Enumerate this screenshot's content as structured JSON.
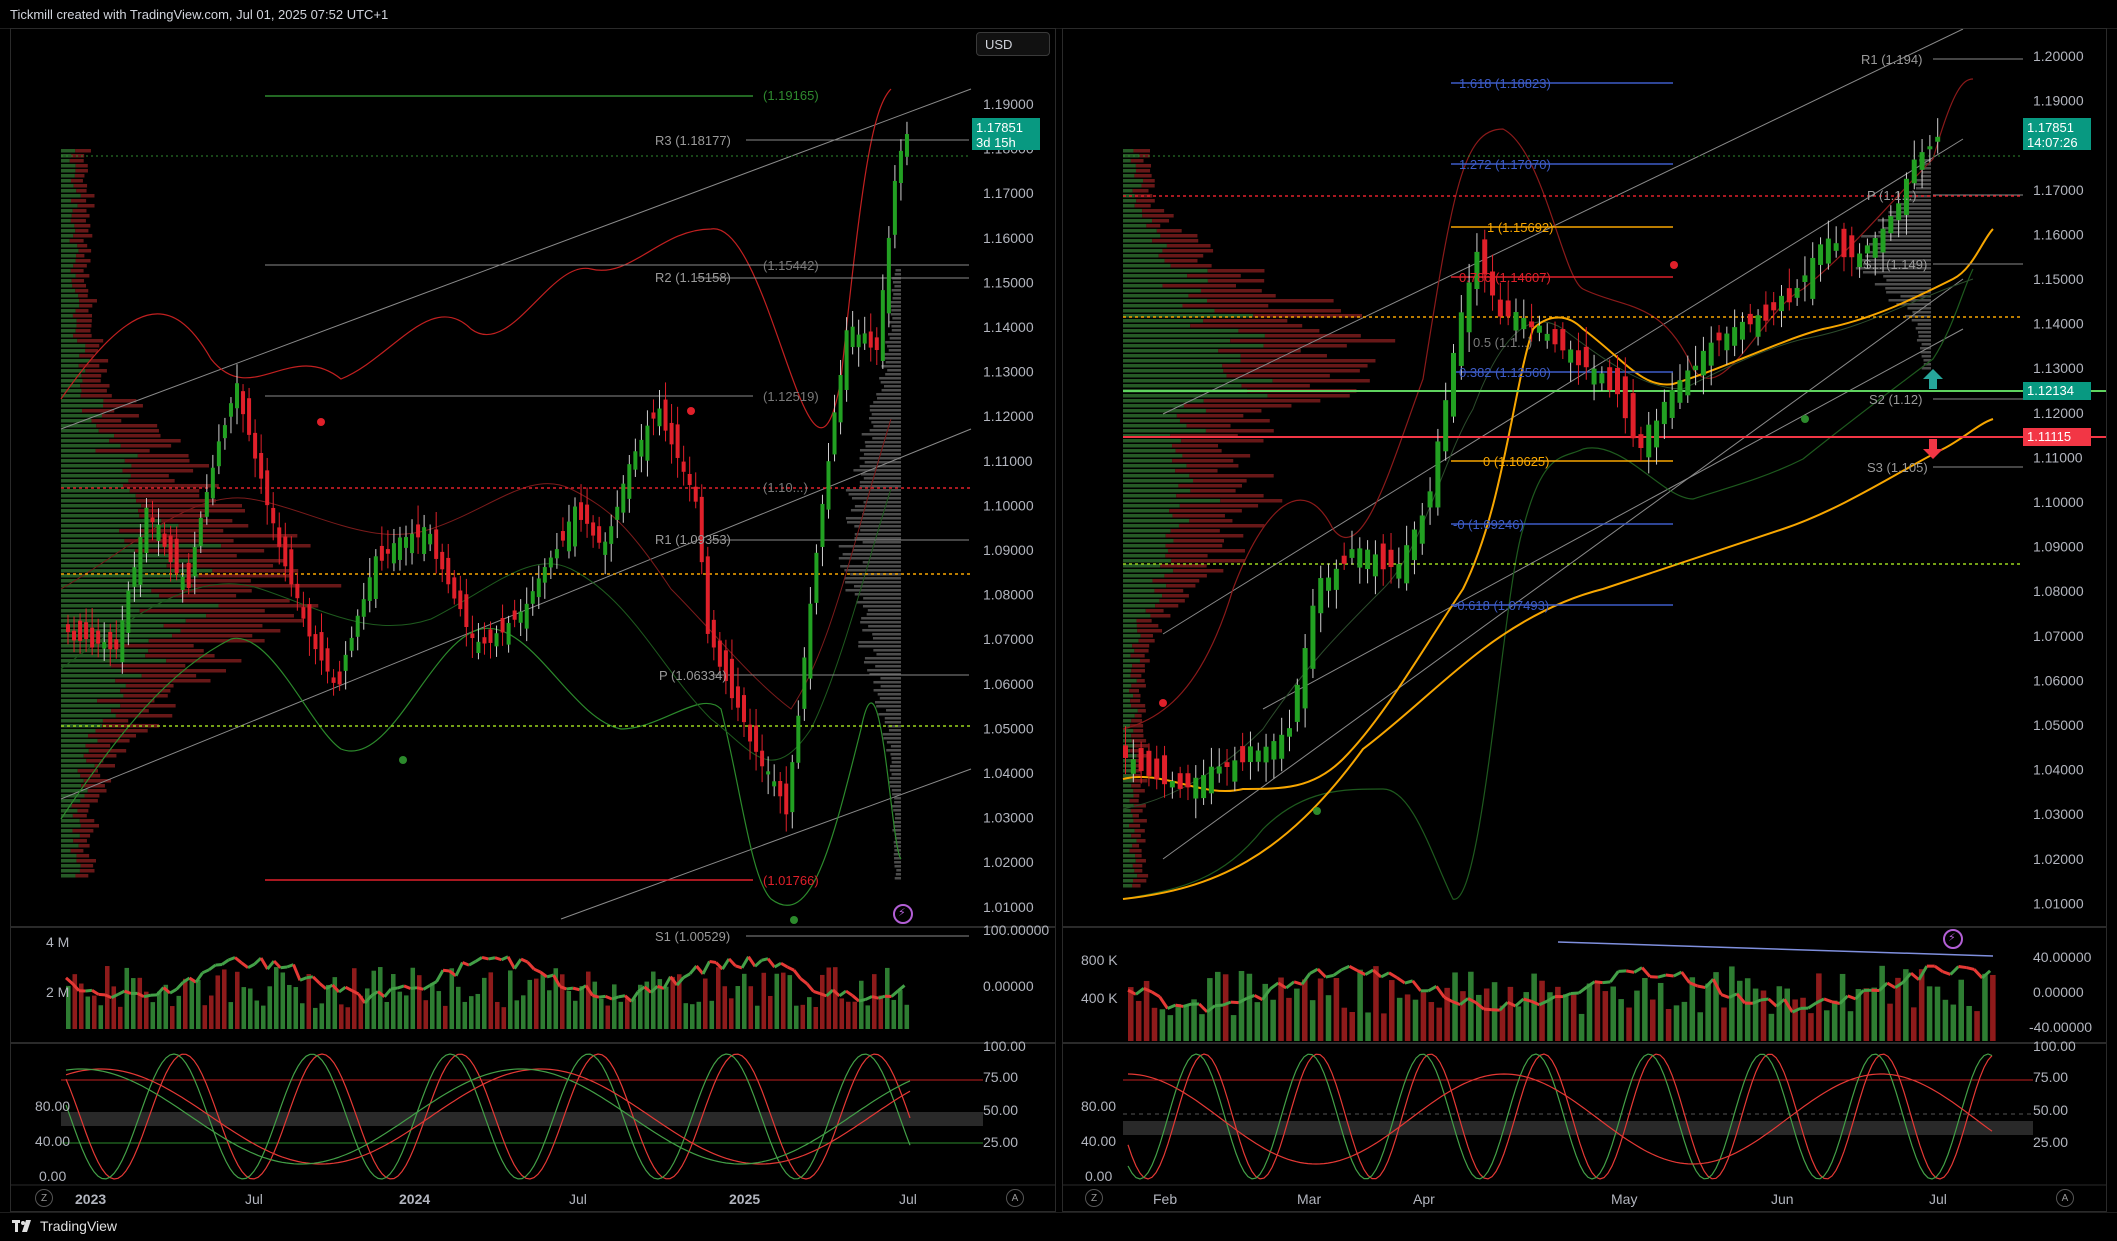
{
  "header": {
    "title": "Tickmill created with TradingView.com, Jul 01, 2025 07:52 UTC+1"
  },
  "footer": {
    "brand": "TradingView"
  },
  "left": {
    "currency": "USD",
    "price_axis": [
      "1.19000",
      "1.18000",
      "1.17000",
      "1.16000",
      "1.15000",
      "1.14000",
      "1.13000",
      "1.12000",
      "1.11000",
      "1.10000",
      "1.09000",
      "1.08000",
      "1.07000",
      "1.06000",
      "1.05000",
      "1.04000",
      "1.03000",
      "1.02000",
      "1.01000"
    ],
    "price_tag": {
      "price": "1.17851",
      "countdown": "3d 15h"
    },
    "levels": {
      "top": "(1.19165)",
      "r3": "R3 (1.18177)",
      "fib_1544": "(1.15442)",
      "r2": "R2 (1.15158)",
      "fib_1251": "(1.12519)",
      "fib_10": "(1.10...)",
      "r1": "R1 (1.09353)",
      "p": "P (1.06334)",
      "low": "(1.01766)",
      "s1": "S1 (1.00529)"
    },
    "time_axis": [
      "2023",
      "Jul",
      "2024",
      "Jul",
      "2025",
      "Jul"
    ],
    "volume_axis": [
      "4 M",
      "2 M"
    ],
    "osc1_axis": [
      "100.00000",
      "0.00000"
    ],
    "osc2_axis_left": [
      "80.00",
      "40.00",
      "0.00"
    ],
    "osc2_axis_right": [
      "100.00",
      "75.00",
      "50.00",
      "25.00"
    ],
    "z_btn": "Z",
    "a_btn": "A"
  },
  "right": {
    "price_axis": [
      "1.20000",
      "1.19000",
      "1.18000",
      "1.17000",
      "1.16000",
      "1.15000",
      "1.14000",
      "1.13000",
      "1.12000",
      "1.11000",
      "1.10000",
      "1.09000",
      "1.08000",
      "1.07000",
      "1.06000",
      "1.05000",
      "1.04000",
      "1.03000",
      "1.02000",
      "1.01000"
    ],
    "price_tag": {
      "price": "1.17851",
      "countdown": "14:07:26"
    },
    "green_tag": "1.12134",
    "red_tag": "1.11115",
    "fibs": {
      "f1618": "1.618 (1.18823)",
      "f1272": "1.272 (1.17070)",
      "f1": "1 (1.15692)",
      "f786": "0.786 (1.14607)",
      "f5": "0.5 (1.1...)",
      "f382": "0.382 (1.12560)",
      "f0": "0 (1.10625)",
      "fm": "-0 (1.09246)",
      "f618": "-0.618 (1.07493)"
    },
    "pivots": {
      "r1": "R1 (1.194)",
      "p": "P (1.1...)",
      "s1": "S... (1.149)",
      "s2": "S2 (1.12)",
      "s3": "S3 (1.105)"
    },
    "time_axis": [
      "Feb",
      "Mar",
      "Apr",
      "May",
      "Jun",
      "Jul"
    ],
    "volume_axis": [
      "800 K",
      "400 K"
    ],
    "osc1_axis": [
      "40.00000",
      "0.00000",
      "-40.00000"
    ],
    "osc2_axis_left": [
      "80.00",
      "40.00",
      "0.00"
    ],
    "osc2_axis_right": [
      "100.00",
      "75.00",
      "50.00",
      "25.00"
    ],
    "z_btn": "Z",
    "a_btn": "A"
  },
  "colors": {
    "bull": "#22a022",
    "bear": "#e0202a",
    "tag_green": "#089981",
    "tag_red": "#f23645",
    "ema": "#f7a600",
    "fib_blue": "#3d5cc7"
  }
}
